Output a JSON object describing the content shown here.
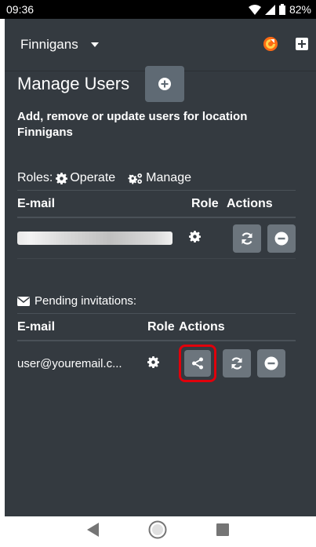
{
  "status_bar": {
    "time": "09:36",
    "battery": "82%"
  },
  "toolbar": {
    "location": "Finnigans"
  },
  "page": {
    "title": "Manage Users",
    "subtitle": "Add, remove or update users for location Finnigans"
  },
  "roles": {
    "prefix": "Roles:",
    "operate": "Operate",
    "manage": "Manage"
  },
  "users_table": {
    "headers": {
      "email": "E-mail",
      "role": "Role",
      "actions": "Actions"
    }
  },
  "pending": {
    "label": "Pending invitations:",
    "headers": {
      "email": "E-mail",
      "role": "Role",
      "actions": "Actions"
    },
    "rows": [
      {
        "email": "user@youremail.c..."
      }
    ]
  },
  "colors": {
    "background": "#343a40",
    "button": "#6c757d",
    "highlight": "#e0000b",
    "brand_logo": "#ff6a13"
  },
  "icons": [
    "wifi-icon",
    "signal-icon",
    "battery-icon",
    "caret-down-icon",
    "refresh-logo-icon",
    "plus-square-icon",
    "plus-circle-icon",
    "gear-icon",
    "cogs-icon",
    "sync-icon",
    "minus-circle-icon",
    "envelope-icon",
    "share-icon",
    "back-icon",
    "home-icon",
    "recents-icon"
  ]
}
